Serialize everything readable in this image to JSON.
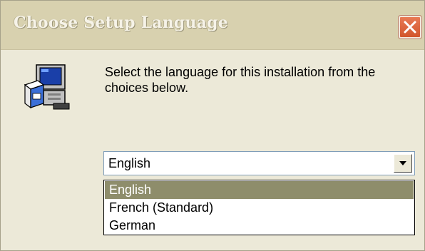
{
  "window": {
    "title": "Choose Setup Language",
    "close_icon": "close-icon"
  },
  "icon": "computer-setup-icon",
  "message": "Select the language for this installation from the choices below.",
  "language_select": {
    "value": "English",
    "options": [
      "English",
      "French (Standard)",
      "German"
    ],
    "highlighted_index": 0
  },
  "colors": {
    "title_bar": "#d8d1af",
    "close_button": "#d9633a",
    "highlight": "#8e8d6b",
    "dialog_background": "#ece9d8"
  }
}
